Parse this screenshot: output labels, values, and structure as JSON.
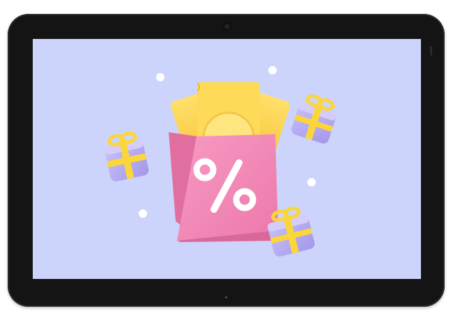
{
  "device": {
    "type": "tablet",
    "orientation": "landscape",
    "frame_color": "#141414"
  },
  "screen": {
    "background_color": "#ccd4fc",
    "illustration": {
      "subject": "shopping-bag-with-coupons",
      "bag_color": "#f48bb6",
      "bag_symbol": "%",
      "coupon_color": "#fcd352",
      "gift_box_color": "#b7aef2",
      "ribbon_color": "#fbd63a",
      "gift_count": 3,
      "sparkle_count": 4
    }
  }
}
